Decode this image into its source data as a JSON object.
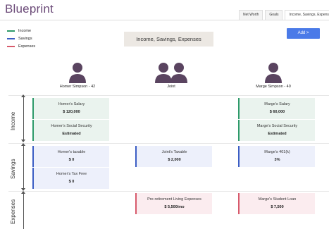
{
  "app": {
    "title": "Blueprint"
  },
  "tabs": [
    {
      "label": "Net Worth",
      "active": false
    },
    {
      "label": "Goals",
      "active": false
    },
    {
      "label": "Income, Savings, Expenses",
      "active": true
    }
  ],
  "legend": [
    {
      "label": "Income",
      "color": "#2e9a6a"
    },
    {
      "label": "Savings",
      "color": "#3c5ec4"
    },
    {
      "label": "Expenses",
      "color": "#d75a6c"
    }
  ],
  "header": {
    "title": "Income, Savings, Expenses"
  },
  "add_button": {
    "label": "Add  >"
  },
  "people": [
    {
      "name": "Homer Simpson - 42",
      "icon": "person-icon"
    },
    {
      "name": "Joint",
      "icon": "couple-icon"
    },
    {
      "name": "Marge Simpson - 40",
      "icon": "person-icon"
    }
  ],
  "sections": {
    "income": {
      "label": "Income"
    },
    "savings": {
      "label": "Savings"
    },
    "expenses": {
      "label": "Expenses"
    }
  },
  "cards": {
    "homer_salary": {
      "title": "Homer's Salary",
      "value": "$ 120,000"
    },
    "homer_ss": {
      "title": "Homer's Social Security",
      "value": "Estimated"
    },
    "marge_salary": {
      "title": "Marge's Salary",
      "value": "$ 60,000"
    },
    "marge_ss": {
      "title": "Marge's Social Security",
      "value": "Estimated"
    },
    "homer_taxable": {
      "title": "Homer's taxable",
      "value": "$ 0"
    },
    "homer_taxfree": {
      "title": "Homer's Tax Free",
      "value": "$ 0"
    },
    "joint_taxable": {
      "title": "Joint's Taxable",
      "value": "$ 2,000"
    },
    "marge_401k": {
      "title": "Marge's 401(k)",
      "value": "3%"
    },
    "pre_retirement": {
      "title": "Pre-retirement Living Expenses",
      "value": "$ 5,500/mo"
    },
    "marge_loan": {
      "title": "Marge's Student Loan",
      "value": "$ 7,500"
    }
  }
}
